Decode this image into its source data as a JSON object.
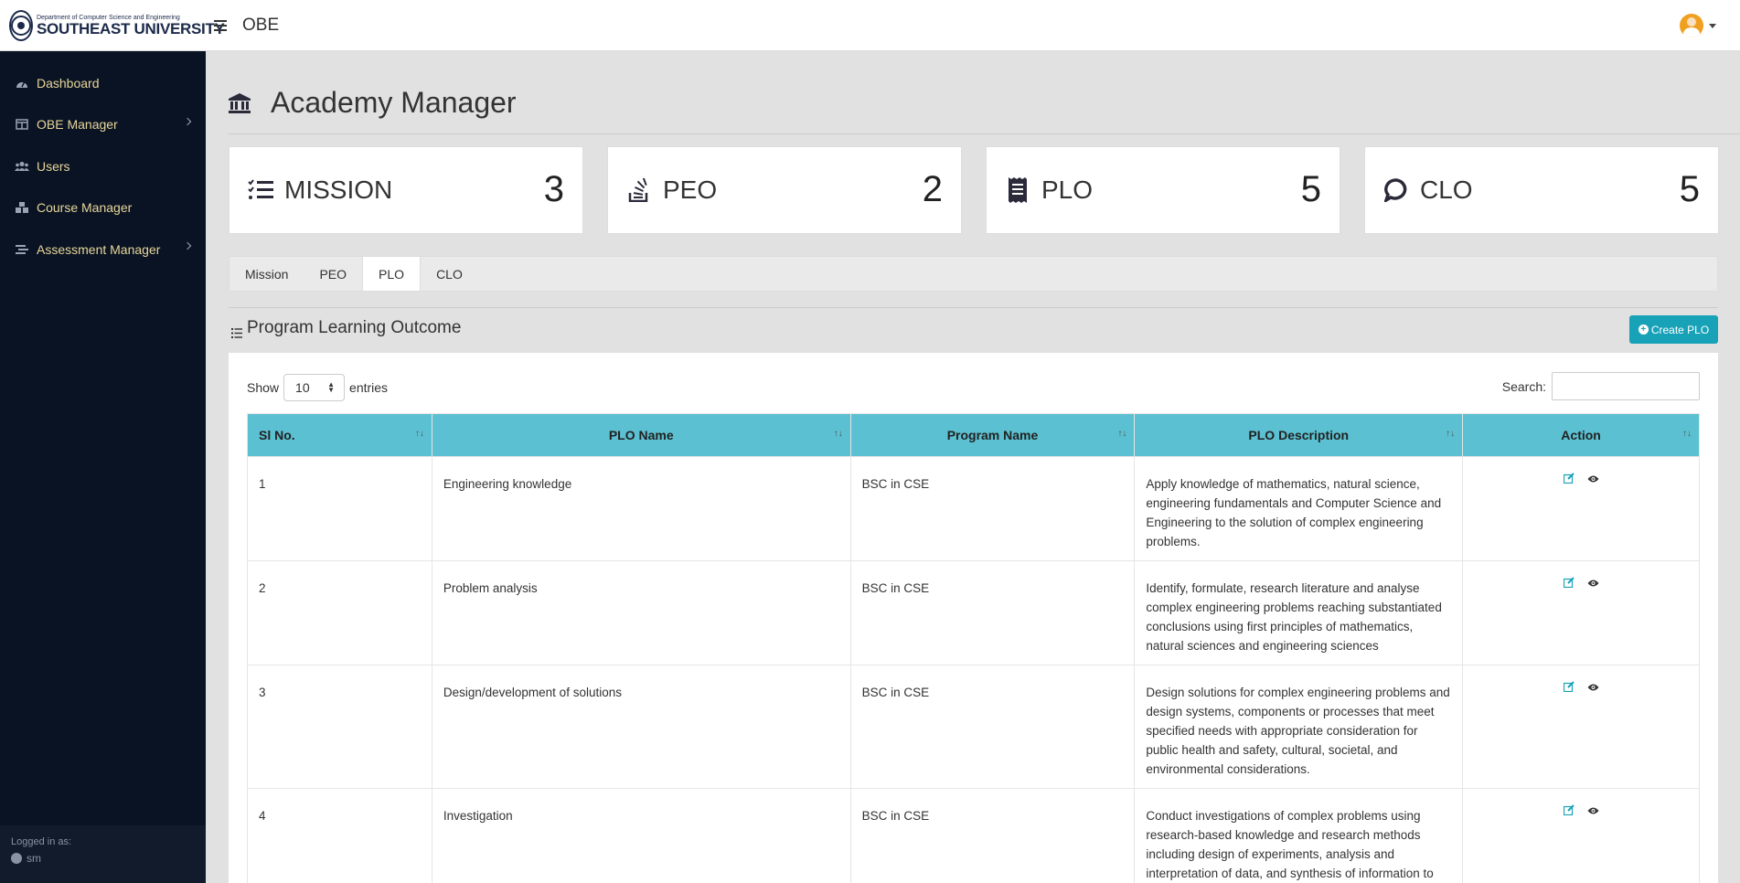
{
  "header": {
    "dept": "Department of Computer Science and Engineering",
    "university": "SOUTHEAST UNIVERSITY",
    "app_title": "OBE"
  },
  "sidebar": {
    "items": [
      {
        "label": "Dashboard",
        "icon": "dashboard-icon"
      },
      {
        "label": "OBE Manager",
        "icon": "table-columns-icon"
      },
      {
        "label": "Users",
        "icon": "users-icon"
      },
      {
        "label": "Course Manager",
        "icon": "boxes-icon"
      },
      {
        "label": "Assessment Manager",
        "icon": "stream-icon"
      }
    ],
    "logged_in_label": "Logged in as:",
    "username": "sm"
  },
  "page": {
    "title": "Academy Manager",
    "icon": "bank-icon"
  },
  "cards": [
    {
      "label": "MISSION",
      "value": "3",
      "icon": "list-check-icon"
    },
    {
      "label": "PEO",
      "value": "2",
      "icon": "stack-overflow-icon"
    },
    {
      "label": "PLO",
      "value": "5",
      "icon": "receipt-icon"
    },
    {
      "label": "CLO",
      "value": "5",
      "icon": "comment-icon"
    }
  ],
  "tabs": [
    "Mission",
    "PEO",
    "PLO",
    "CLO"
  ],
  "active_tab": "PLO",
  "section": {
    "title": "Program Learning Outcome",
    "create_label": "Create PLO"
  },
  "table_controls": {
    "show_label": "Show",
    "entries_value": "10",
    "entries_label": "entries",
    "search_label": "Search:"
  },
  "table": {
    "headers": [
      "Sl No.",
      "PLO Name",
      "Program Name",
      "PLO Description",
      "Action"
    ],
    "rows": [
      {
        "sl": "1",
        "name": "Engineering knowledge",
        "program": "BSC in CSE",
        "description": "Apply knowledge of mathematics, natural science, engineering fundamentals and Computer Science and Engineering to the solution of complex engineering problems."
      },
      {
        "sl": "2",
        "name": "Problem analysis",
        "program": "BSC in CSE",
        "description": "Identify, formulate, research literature and analyse complex engineering problems reaching substantiated conclusions using first principles of mathematics, natural sciences and engineering sciences"
      },
      {
        "sl": "3",
        "name": "Design/development of solutions",
        "program": "BSC in CSE",
        "description": "Design solutions for complex engineering problems and design systems, components or processes that meet specified needs with appropriate consideration for public health and safety, cultural, societal, and environmental considerations."
      },
      {
        "sl": "4",
        "name": "Investigation",
        "program": "BSC in CSE",
        "description": "Conduct investigations of complex problems using research-based knowledge and research methods including design of experiments, analysis and interpretation of data, and synthesis of information to provide valid conclusions."
      }
    ]
  },
  "colors": {
    "sidebar_bg": "#0a1323",
    "sidebar_text": "#e7d69a",
    "table_header": "#5bc0d1",
    "button_accent": "#17a2b8",
    "page_bg": "#e1e1e1"
  }
}
